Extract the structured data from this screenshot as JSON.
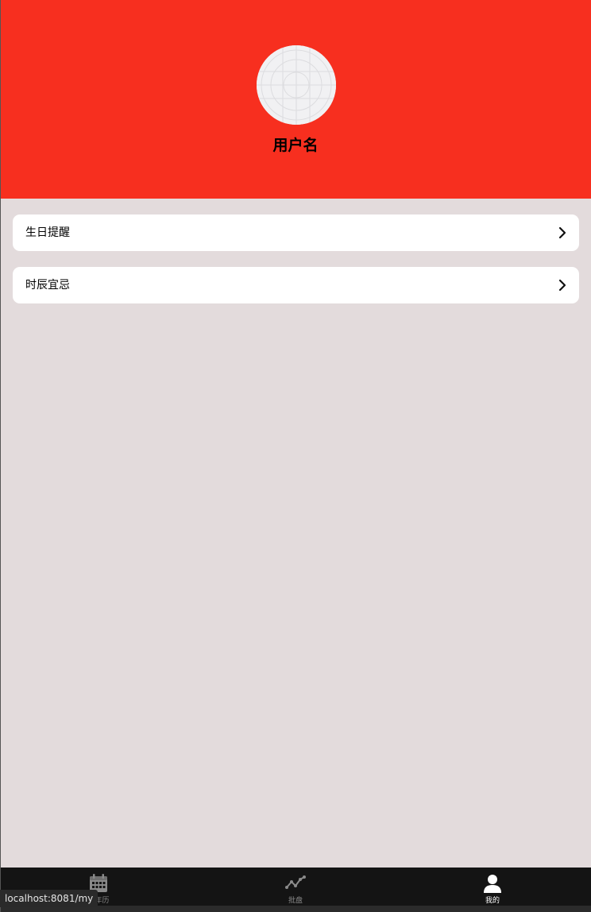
{
  "header": {
    "username": "用户名",
    "background_color": "#f72f1f",
    "avatar_icon": "avatar-placeholder-icon"
  },
  "menu": {
    "items": [
      {
        "label": "生日提醒",
        "icon": "chevron-right-icon"
      },
      {
        "label": "时辰宜忌",
        "icon": "chevron-right-icon"
      }
    ]
  },
  "tabbar": {
    "tabs": [
      {
        "label": "万年历",
        "icon": "calendar-icon",
        "active": false
      },
      {
        "label": "批盘",
        "icon": "trend-line-icon",
        "active": false
      },
      {
        "label": "我的",
        "icon": "user-icon",
        "active": true
      }
    ]
  },
  "status_bar": {
    "url": "localhost:8081/my"
  },
  "colors": {
    "page_background": "#e3dbdc",
    "card_background": "#ffffff",
    "tabbar_background": "#141414",
    "tab_inactive": "#8a8a8a",
    "tab_active": "#ffffff"
  }
}
